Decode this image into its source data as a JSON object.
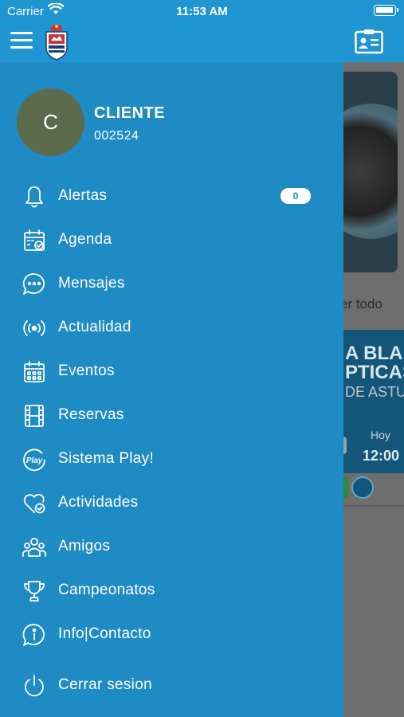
{
  "status_bar": {
    "carrier": "Carrier",
    "time": "11:53 AM"
  },
  "header": {
    "menu_icon": "hamburger-menu-icon",
    "logo": "club-crest-logo",
    "right_icon": "member-card-icon"
  },
  "colors": {
    "accent": "#1f95d2",
    "drawer": "#1f8bc5",
    "avatar": "#5c6b4b"
  },
  "user": {
    "initial": "C",
    "name": "CLIENTE",
    "code": "002524"
  },
  "menu": [
    {
      "label": "Alertas",
      "icon": "bell-icon",
      "badge": "0"
    },
    {
      "label": "Agenda",
      "icon": "calendar-check-icon"
    },
    {
      "label": "Mensajes",
      "icon": "chat-bubble-icon"
    },
    {
      "label": "Actualidad",
      "icon": "broadcast-icon"
    },
    {
      "label": "Eventos",
      "icon": "calendar-grid-icon"
    },
    {
      "label": "Reservas",
      "icon": "film-strip-icon"
    },
    {
      "label": "Sistema Play!",
      "icon": "play-circle-icon"
    },
    {
      "label": "Actividades",
      "icon": "heart-check-icon"
    },
    {
      "label": "Amigos",
      "icon": "group-icon"
    },
    {
      "label": "Campeonatos",
      "icon": "trophy-icon"
    },
    {
      "label": "Info|Contacto",
      "icon": "info-icon"
    },
    {
      "label": "Cerrar sesion",
      "icon": "power-icon"
    }
  ],
  "background": {
    "ver_todo": "er todo",
    "banner_line1": "A BLAN",
    "banner_line2": "PTICAS",
    "banner_line3": "DE ASTU",
    "day": "Hoy",
    "hour": "12:00"
  }
}
